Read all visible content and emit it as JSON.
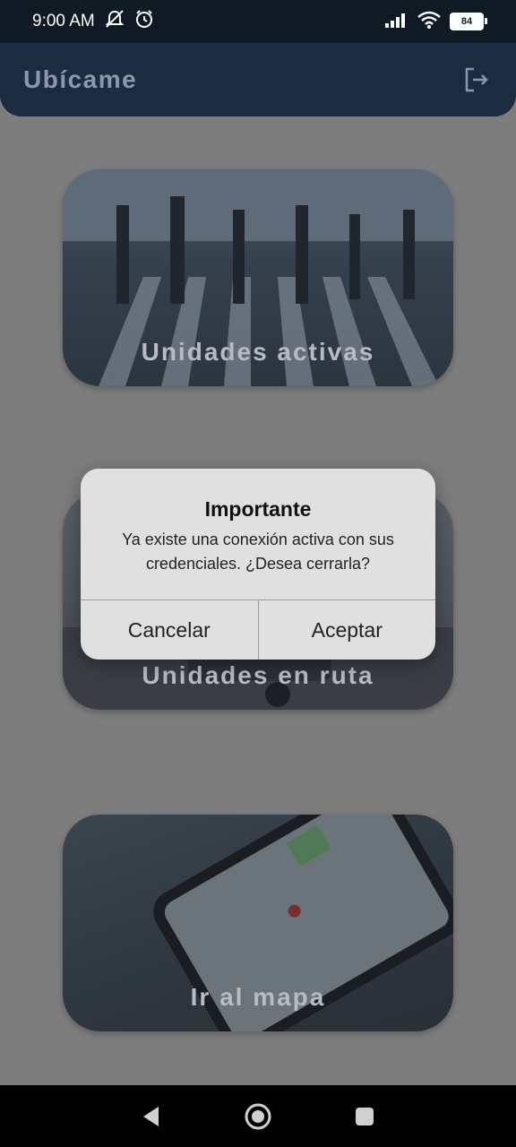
{
  "status_bar": {
    "time": "9:00 AM",
    "battery": "84",
    "icons": [
      "mute-icon",
      "alarm-icon",
      "signal-icon",
      "wifi-icon"
    ]
  },
  "app_bar": {
    "title": "Ubícame",
    "logout_icon": "logout-icon"
  },
  "cards": [
    {
      "label": "Unidades activas"
    },
    {
      "label": "Unidades en ruta"
    },
    {
      "label": "Ir al mapa"
    }
  ],
  "dialog": {
    "title": "Importante",
    "message": "Ya existe una conexión activa con sus credenciales. ¿Desea cerrarla?",
    "cancel_label": "Cancelar",
    "accept_label": "Aceptar"
  },
  "nav_bar": {
    "icons": [
      "back-icon",
      "home-icon",
      "recents-icon"
    ]
  }
}
